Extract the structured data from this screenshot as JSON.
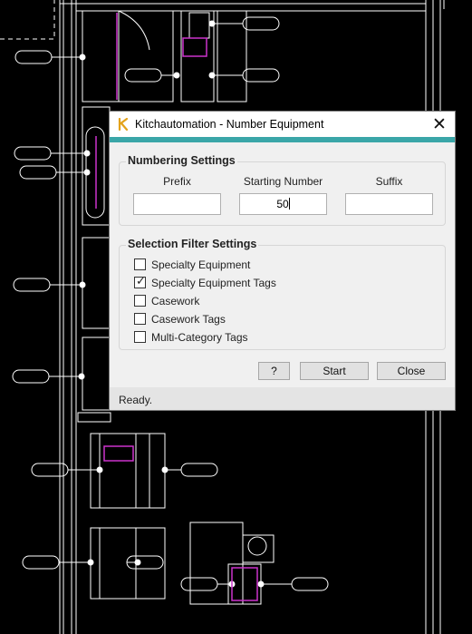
{
  "dialog": {
    "title": "Kitchautomation - Number Equipment",
    "close_glyph": "✕",
    "logo_icon": "kitchautomation-logo-icon",
    "accent_color": "#3aa6a8",
    "numbering": {
      "title": "Numbering Settings",
      "prefix_label": "Prefix",
      "prefix_value": "",
      "starting_label": "Starting Number",
      "starting_value": "50",
      "suffix_label": "Suffix",
      "suffix_value": ""
    },
    "filter": {
      "title": "Selection Filter Settings",
      "items": [
        {
          "label": "Specialty Equipment",
          "checked": false
        },
        {
          "label": "Specialty Equipment Tags",
          "checked": true
        },
        {
          "label": "Casework",
          "checked": false
        },
        {
          "label": "Casework Tags",
          "checked": false
        },
        {
          "label": "Multi-Category Tags",
          "checked": false
        }
      ]
    },
    "buttons": {
      "help": "?",
      "start": "Start",
      "close": "Close"
    },
    "status": "Ready."
  },
  "colors": {
    "background": "#000000",
    "cad_lines": "#ffffff",
    "highlight": "#cc33cc"
  }
}
